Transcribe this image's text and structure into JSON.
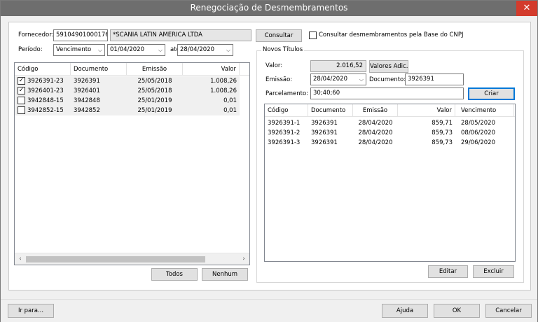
{
  "window": {
    "title": "Renegociação de Desmembramentos",
    "close_glyph": "✕"
  },
  "fornecedor": {
    "label": "Fornecedor:",
    "cnpj": "59104901000176",
    "name": "*SCANIA LATIN AMERICA LTDA",
    "consultar_label": "Consultar",
    "cnpj_checkbox_label": "Consultar desmembramentos pela Base do CNPJ",
    "cnpj_checked": false
  },
  "periodo": {
    "label": "Período:",
    "type": "Vencimento",
    "from": "01/04/2020",
    "to_label": "até",
    "to": "28/04/2020"
  },
  "left_table": {
    "columns": [
      "Código",
      "Documento",
      "Emissão",
      "Valor"
    ],
    "rows": [
      {
        "checked": true,
        "codigo": "3926391-23",
        "documento": "3926391",
        "emissao": "25/05/2018",
        "valor": "1.008,26"
      },
      {
        "checked": true,
        "codigo": "3926401-23",
        "documento": "3926401",
        "emissao": "25/05/2018",
        "valor": "1.008,26"
      },
      {
        "checked": false,
        "codigo": "3942848-15",
        "documento": "3942848",
        "emissao": "25/01/2019",
        "valor": "0,01"
      },
      {
        "checked": false,
        "codigo": "3942852-15",
        "documento": "3942852",
        "emissao": "25/01/2019",
        "valor": "0,01"
      }
    ],
    "todos_label": "Todos",
    "nenhum_label": "Nenhum"
  },
  "novos": {
    "group_title": "Novos Títulos",
    "valor_label": "Valor:",
    "valor": "2.016,52",
    "valores_adic_label": "Valores Adic.",
    "emissao_label": "Emissão:",
    "emissao": "28/04/2020",
    "documento_label": "Documento:",
    "documento": "3926391",
    "parcelamento_label": "Parcelamento:",
    "parcelamento": "30;40;60",
    "criar_label": "Criar",
    "columns": [
      "Código",
      "Documento",
      "Emissão",
      "Valor",
      "Vencimento"
    ],
    "rows": [
      {
        "codigo": "3926391-1",
        "documento": "3926391",
        "emissao": "28/04/2020",
        "valor": "859,71",
        "vencimento": "28/05/2020"
      },
      {
        "codigo": "3926391-2",
        "documento": "3926391",
        "emissao": "28/04/2020",
        "valor": "859,73",
        "vencimento": "08/06/2020"
      },
      {
        "codigo": "3926391-3",
        "documento": "3926391",
        "emissao": "28/04/2020",
        "valor": "859,73",
        "vencimento": "29/06/2020"
      }
    ],
    "editar_label": "Editar",
    "excluir_label": "Excluir"
  },
  "footer": {
    "ir_para_label": "Ir para...",
    "ajuda_label": "Ajuda",
    "ok_label": "OK",
    "cancelar_label": "Cancelar"
  },
  "colors": {
    "titlebar": "#6e6e6e",
    "close": "#d33b2c",
    "focus": "#0078d7",
    "selected_row": "#f0f0f0"
  }
}
